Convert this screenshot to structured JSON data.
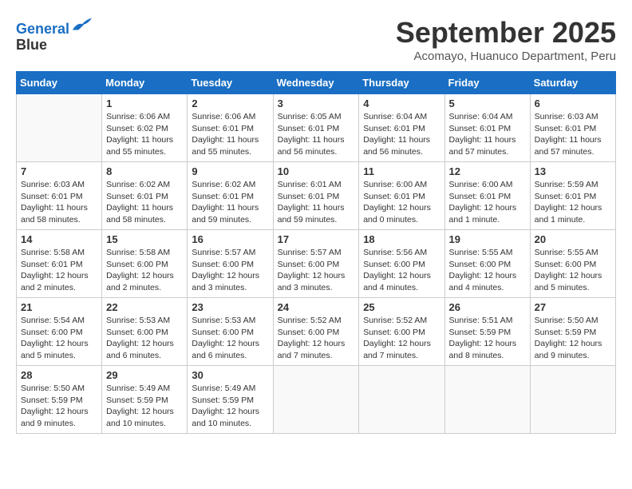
{
  "header": {
    "logo_line1": "General",
    "logo_line2": "Blue",
    "month_title": "September 2025",
    "location": "Acomayo, Huanuco Department, Peru"
  },
  "days_of_week": [
    "Sunday",
    "Monday",
    "Tuesday",
    "Wednesday",
    "Thursday",
    "Friday",
    "Saturday"
  ],
  "weeks": [
    [
      {
        "day": "",
        "info": ""
      },
      {
        "day": "1",
        "info": "Sunrise: 6:06 AM\nSunset: 6:02 PM\nDaylight: 11 hours\nand 55 minutes."
      },
      {
        "day": "2",
        "info": "Sunrise: 6:06 AM\nSunset: 6:01 PM\nDaylight: 11 hours\nand 55 minutes."
      },
      {
        "day": "3",
        "info": "Sunrise: 6:05 AM\nSunset: 6:01 PM\nDaylight: 11 hours\nand 56 minutes."
      },
      {
        "day": "4",
        "info": "Sunrise: 6:04 AM\nSunset: 6:01 PM\nDaylight: 11 hours\nand 56 minutes."
      },
      {
        "day": "5",
        "info": "Sunrise: 6:04 AM\nSunset: 6:01 PM\nDaylight: 11 hours\nand 57 minutes."
      },
      {
        "day": "6",
        "info": "Sunrise: 6:03 AM\nSunset: 6:01 PM\nDaylight: 11 hours\nand 57 minutes."
      }
    ],
    [
      {
        "day": "7",
        "info": "Sunrise: 6:03 AM\nSunset: 6:01 PM\nDaylight: 11 hours\nand 58 minutes."
      },
      {
        "day": "8",
        "info": "Sunrise: 6:02 AM\nSunset: 6:01 PM\nDaylight: 11 hours\nand 58 minutes."
      },
      {
        "day": "9",
        "info": "Sunrise: 6:02 AM\nSunset: 6:01 PM\nDaylight: 11 hours\nand 59 minutes."
      },
      {
        "day": "10",
        "info": "Sunrise: 6:01 AM\nSunset: 6:01 PM\nDaylight: 11 hours\nand 59 minutes."
      },
      {
        "day": "11",
        "info": "Sunrise: 6:00 AM\nSunset: 6:01 PM\nDaylight: 12 hours\nand 0 minutes."
      },
      {
        "day": "12",
        "info": "Sunrise: 6:00 AM\nSunset: 6:01 PM\nDaylight: 12 hours\nand 1 minute."
      },
      {
        "day": "13",
        "info": "Sunrise: 5:59 AM\nSunset: 6:01 PM\nDaylight: 12 hours\nand 1 minute."
      }
    ],
    [
      {
        "day": "14",
        "info": "Sunrise: 5:58 AM\nSunset: 6:01 PM\nDaylight: 12 hours\nand 2 minutes."
      },
      {
        "day": "15",
        "info": "Sunrise: 5:58 AM\nSunset: 6:00 PM\nDaylight: 12 hours\nand 2 minutes."
      },
      {
        "day": "16",
        "info": "Sunrise: 5:57 AM\nSunset: 6:00 PM\nDaylight: 12 hours\nand 3 minutes."
      },
      {
        "day": "17",
        "info": "Sunrise: 5:57 AM\nSunset: 6:00 PM\nDaylight: 12 hours\nand 3 minutes."
      },
      {
        "day": "18",
        "info": "Sunrise: 5:56 AM\nSunset: 6:00 PM\nDaylight: 12 hours\nand 4 minutes."
      },
      {
        "day": "19",
        "info": "Sunrise: 5:55 AM\nSunset: 6:00 PM\nDaylight: 12 hours\nand 4 minutes."
      },
      {
        "day": "20",
        "info": "Sunrise: 5:55 AM\nSunset: 6:00 PM\nDaylight: 12 hours\nand 5 minutes."
      }
    ],
    [
      {
        "day": "21",
        "info": "Sunrise: 5:54 AM\nSunset: 6:00 PM\nDaylight: 12 hours\nand 5 minutes."
      },
      {
        "day": "22",
        "info": "Sunrise: 5:53 AM\nSunset: 6:00 PM\nDaylight: 12 hours\nand 6 minutes."
      },
      {
        "day": "23",
        "info": "Sunrise: 5:53 AM\nSunset: 6:00 PM\nDaylight: 12 hours\nand 6 minutes."
      },
      {
        "day": "24",
        "info": "Sunrise: 5:52 AM\nSunset: 6:00 PM\nDaylight: 12 hours\nand 7 minutes."
      },
      {
        "day": "25",
        "info": "Sunrise: 5:52 AM\nSunset: 6:00 PM\nDaylight: 12 hours\nand 7 minutes."
      },
      {
        "day": "26",
        "info": "Sunrise: 5:51 AM\nSunset: 5:59 PM\nDaylight: 12 hours\nand 8 minutes."
      },
      {
        "day": "27",
        "info": "Sunrise: 5:50 AM\nSunset: 5:59 PM\nDaylight: 12 hours\nand 9 minutes."
      }
    ],
    [
      {
        "day": "28",
        "info": "Sunrise: 5:50 AM\nSunset: 5:59 PM\nDaylight: 12 hours\nand 9 minutes."
      },
      {
        "day": "29",
        "info": "Sunrise: 5:49 AM\nSunset: 5:59 PM\nDaylight: 12 hours\nand 10 minutes."
      },
      {
        "day": "30",
        "info": "Sunrise: 5:49 AM\nSunset: 5:59 PM\nDaylight: 12 hours\nand 10 minutes."
      },
      {
        "day": "",
        "info": ""
      },
      {
        "day": "",
        "info": ""
      },
      {
        "day": "",
        "info": ""
      },
      {
        "day": "",
        "info": ""
      }
    ]
  ]
}
